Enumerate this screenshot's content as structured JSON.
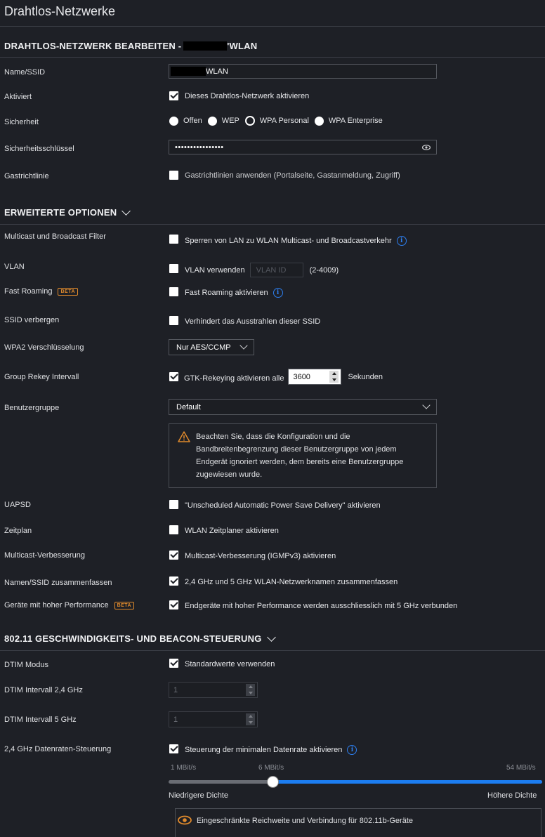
{
  "page_title": "Drahtlos-Netzwerke",
  "section_edit": {
    "title_prefix": "DRAHTLOS-NETZWERK BEARBEITEN -",
    "title_suffix": "'WLAN"
  },
  "fields": {
    "name_label": "Name/SSID",
    "name_value_suffix": "WLAN",
    "enabled_label": "Aktiviert",
    "enabled_text": "Dieses Drahtlos-Netzwerk aktivieren",
    "security_label": "Sicherheit",
    "security_options": [
      "Offen",
      "WEP",
      "WPA Personal",
      "WPA Enterprise"
    ],
    "security_selected": "WPA Personal",
    "key_label": "Sicherheitsschlüssel",
    "key_value": "••••••••••••••••",
    "guest_label": "Gastrichtlinie",
    "guest_text": "Gastrichtlinien anwenden (Portalseite, Gastanmeldung, Zugriff)"
  },
  "section_advanced": {
    "title": "ERWEITERTE OPTIONEN",
    "multicast_label": "Multicast und Broadcast Filter",
    "multicast_text": "Sperren von LAN zu WLAN Multicast- und Broadcastverkehr",
    "vlan_label": "VLAN",
    "vlan_text": "VLAN verwenden",
    "vlan_placeholder": "VLAN ID",
    "vlan_range": "(2-4009)",
    "roaming_label": "Fast Roaming",
    "beta_badge": "BETA",
    "roaming_text": "Fast Roaming aktivieren",
    "hide_label": "SSID verbergen",
    "hide_text": "Verhindert das Ausstrahlen dieser SSID",
    "wpa2_label": "WPA2 Verschlüsselung",
    "wpa2_value": "Nur AES/CCMP",
    "rekey_label": "Group Rekey Intervall",
    "rekey_text": "GTK-Rekeying aktivieren alle",
    "rekey_value": "3600",
    "rekey_unit": "Sekunden",
    "usergroup_label": "Benutzergruppe",
    "usergroup_value": "Default",
    "usergroup_warning": "Beachten Sie, dass die Konfiguration und die Bandbreitenbegrenzung dieser Benutzergruppe von jedem Endgerät ignoriert werden, dem bereits eine Benutzergruppe zugewiesen wurde.",
    "uapsd_label": "UAPSD",
    "uapsd_text": "\"Unscheduled Automatic Power Save Delivery\" aktivieren",
    "schedule_label": "Zeitplan",
    "schedule_text": "WLAN Zeitplaner aktivieren",
    "mcast_enh_label": "Multicast-Verbesserung",
    "mcast_enh_text": "Multicast-Verbesserung (IGMPv3) aktivieren",
    "combine_label": "Namen/SSID zusammenfassen",
    "combine_text": "2,4 GHz und 5 GHz WLAN-Netzwerknamen zusammenfassen",
    "highperf_label": "Geräte mit hoher Performance",
    "highperf_text": "Endgeräte mit hoher Performance werden ausschliesslich mit 5 GHz verbunden"
  },
  "section_rate": {
    "title": "802.11 GESCHWINDIGKEITS- UND BEACON-STEUERUNG",
    "dtim_mode_label": "DTIM Modus",
    "dtim_mode_text": "Standardwerte verwenden",
    "dtim24_label": "DTIM Intervall 2,4 GHz",
    "dtim24_value": "1",
    "dtim5_label": "DTIM Intervall 5 GHz",
    "dtim5_value": "1",
    "rate_label": "2,4 GHz Datenraten-Steuerung",
    "rate_text": "Steuerung der minimalen Datenrate aktivieren",
    "rate_min": "1 MBit/s",
    "rate_current": "6 MBit/s",
    "rate_max": "54 MBit/s",
    "rate_slider_fraction": 0.28,
    "density_low": "Niedrigere Dichte",
    "density_high": "Höhere Dichte",
    "legacy_text": "Eingeschränkte Reichweite und Verbindung für 802.11b-Geräte"
  },
  "checkbox_states": {
    "enabled": true,
    "guest": false,
    "multicast": false,
    "vlan": false,
    "roaming": false,
    "hide": false,
    "rekey": true,
    "uapsd": false,
    "schedule": false,
    "mcast_enh": true,
    "combine": true,
    "highperf": true,
    "dtim_mode": true,
    "rate": true
  },
  "colors": {
    "background": "#1e2026",
    "accent": "#1c7df0",
    "beta": "#e08a2c"
  }
}
